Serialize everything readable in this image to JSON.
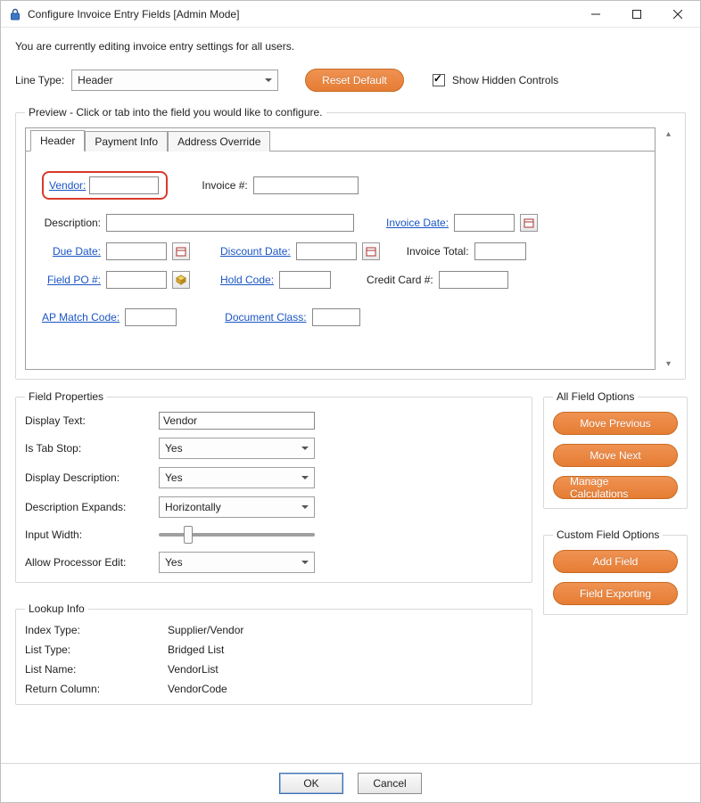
{
  "window": {
    "title": "Configure Invoice Entry Fields [Admin Mode]"
  },
  "intro": "You are currently editing invoice entry settings for all users.",
  "linetype": {
    "label": "Line Type:",
    "value": "Header",
    "reset": "Reset Default",
    "show_hidden_label": "Show Hidden Controls",
    "show_hidden_checked": true
  },
  "preview": {
    "legend": "Preview - Click or tab into the field you would like to configure.",
    "tabs": [
      {
        "label": "Header",
        "active": true
      },
      {
        "label": "Payment Info",
        "active": false
      },
      {
        "label": "Address Override",
        "active": false
      }
    ],
    "fields": {
      "vendor": "Vendor:",
      "invoice_no": "Invoice #:",
      "description": "Description:",
      "invoice_date": "Invoice Date:",
      "due_date": "Due Date:",
      "discount_date": "Discount Date:",
      "invoice_total": "Invoice Total:",
      "field_po": "Field PO #:",
      "hold_code": "Hold Code:",
      "credit_card": "Credit Card #:",
      "ap_match": "AP Match Code:",
      "doc_class": "Document Class:"
    }
  },
  "field_props": {
    "legend": "Field Properties",
    "display_text": {
      "label": "Display Text:",
      "value": "Vendor"
    },
    "is_tab_stop": {
      "label": "Is Tab Stop:",
      "value": "Yes"
    },
    "display_desc": {
      "label": "Display Description:",
      "value": "Yes"
    },
    "desc_expands": {
      "label": "Description Expands:",
      "value": "Horizontally"
    },
    "input_width": {
      "label": "Input Width:"
    },
    "allow_edit": {
      "label": "Allow Processor Edit:",
      "value": "Yes"
    }
  },
  "lookup": {
    "legend": "Lookup Info",
    "index_type": {
      "label": "Index Type:",
      "value": "Supplier/Vendor"
    },
    "list_type": {
      "label": "List Type:",
      "value": "Bridged List"
    },
    "list_name": {
      "label": "List Name:",
      "value": "VendorList"
    },
    "return_col": {
      "label": "Return Column:",
      "value": "VendorCode"
    }
  },
  "all_opts": {
    "legend": "All Field Options",
    "move_prev": "Move Previous",
    "move_next": "Move Next",
    "manage_calc": "Manage Calculations"
  },
  "custom_opts": {
    "legend": "Custom Field Options",
    "add_field": "Add Field",
    "field_exporting": "Field Exporting"
  },
  "footer": {
    "ok": "OK",
    "cancel": "Cancel"
  }
}
